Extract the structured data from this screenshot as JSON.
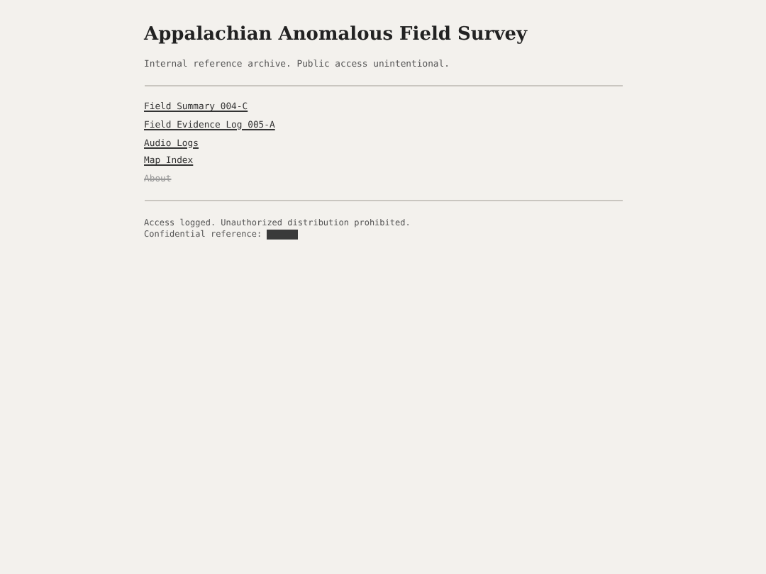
{
  "header": {
    "title": "Appalachian Anomalous Field Survey",
    "subtitle": "Internal reference archive. Public access unintentional."
  },
  "links": [
    {
      "label": "Field Summary 004-C",
      "disabled": false
    },
    {
      "label": "Field Evidence Log 005-A",
      "disabled": false
    },
    {
      "label": "Audio Logs",
      "disabled": false
    },
    {
      "label": "Map Index",
      "disabled": false
    },
    {
      "label": "About",
      "disabled": true
    }
  ],
  "footer": {
    "notice": "Access logged. Unauthorized distribution prohibited.",
    "reference_label": "Confidential reference:",
    "reference_redacted": true
  }
}
